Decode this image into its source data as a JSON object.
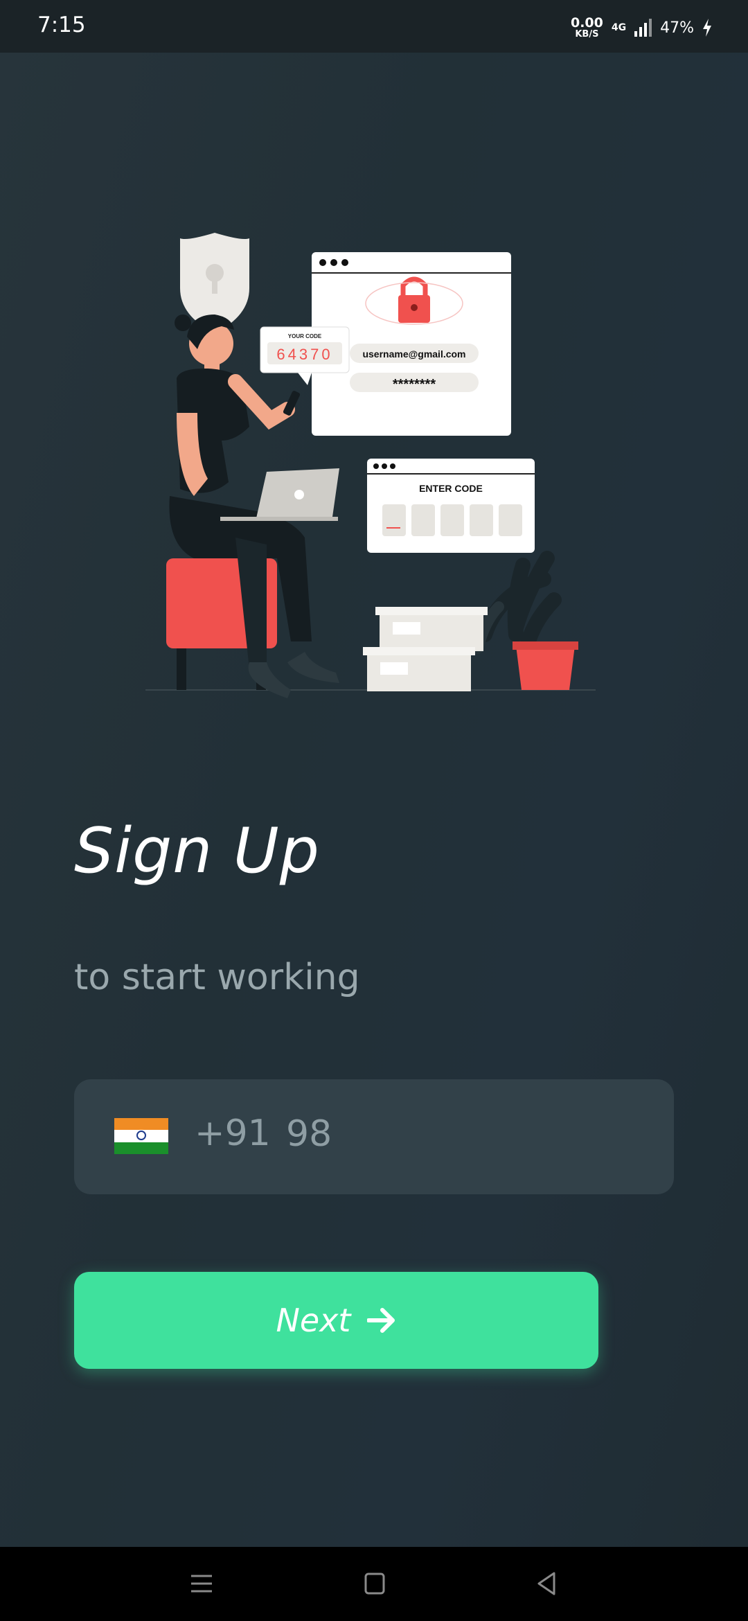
{
  "status_bar": {
    "time": "7:15",
    "speed_value": "0.00",
    "speed_unit": "KB/S",
    "network": "4G",
    "battery": "47%"
  },
  "heading": {
    "title": "Sign Up",
    "subtitle": "to start working"
  },
  "phone_input": {
    "country_flag": "india-flag",
    "country_code": "+91",
    "value": "98"
  },
  "next_button": {
    "label": "Next",
    "icon": "arrow-right-icon"
  },
  "illustration": {
    "code_card_title": "YOUR CODE",
    "code_value": "64370",
    "username": "username@gmail.com",
    "password": "********",
    "enter_code_title": "ENTER CODE"
  },
  "colors": {
    "background": "#22303a",
    "accent": "#3fe19d",
    "input_bg": "#324149",
    "illustration_red": "#f0514e"
  }
}
